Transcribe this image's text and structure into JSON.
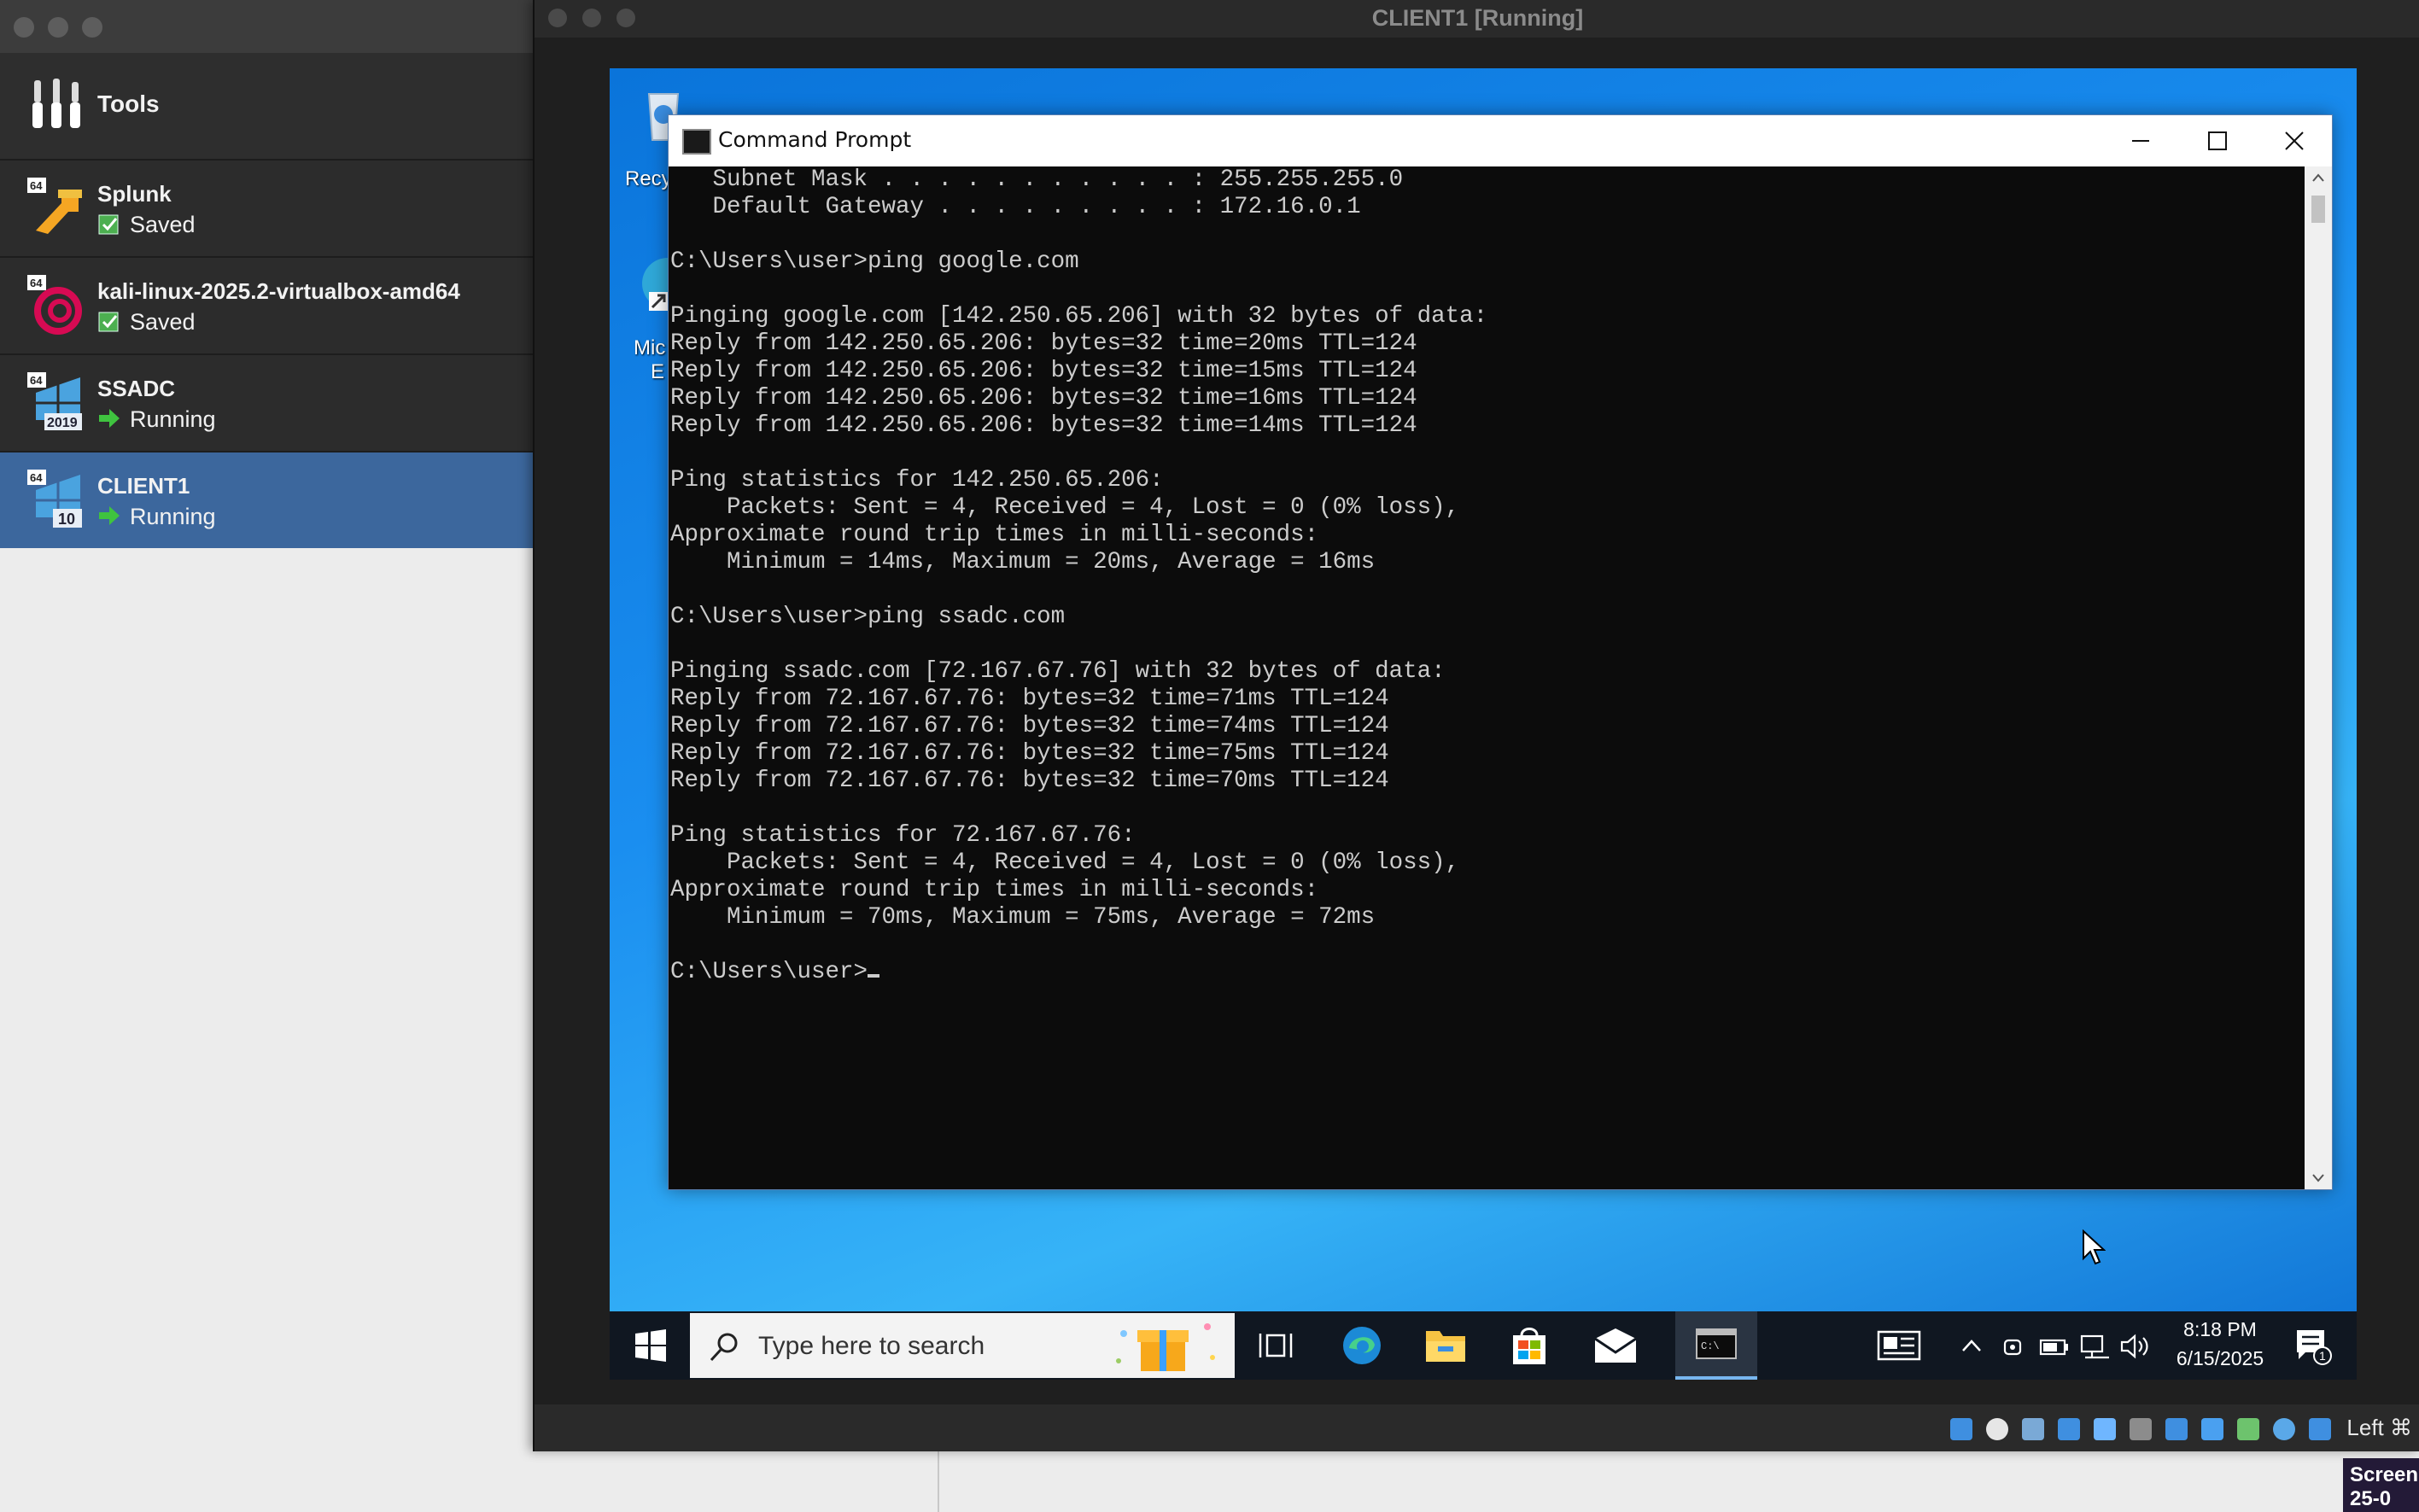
{
  "manager": {
    "tools_label": "Tools",
    "vms": [
      {
        "name": "Splunk",
        "state": "Saved"
      },
      {
        "name": "kali-linux-2025.2-virtualbox-amd64",
        "state": "Saved"
      },
      {
        "name": "SSADC",
        "state": "Running",
        "badge": "2019"
      },
      {
        "name": "CLIENT1",
        "state": "Running",
        "badge": "10"
      }
    ]
  },
  "vm_window": {
    "title": "CLIENT1 [Running]",
    "host_key": "Left ⌘"
  },
  "desktop": {
    "recycle_label": "Recy",
    "edge_label_line1": "Mic",
    "edge_label_line2": "E"
  },
  "cmd": {
    "title": "Command Prompt",
    "lines": [
      "   Subnet Mask . . . . . . . . . . . : 255.255.255.0",
      "   Default Gateway . . . . . . . . . : 172.16.0.1",
      "",
      "C:\\Users\\user>ping google.com",
      "",
      "Pinging google.com [142.250.65.206] with 32 bytes of data:",
      "Reply from 142.250.65.206: bytes=32 time=20ms TTL=124",
      "Reply from 142.250.65.206: bytes=32 time=15ms TTL=124",
      "Reply from 142.250.65.206: bytes=32 time=16ms TTL=124",
      "Reply from 142.250.65.206: bytes=32 time=14ms TTL=124",
      "",
      "Ping statistics for 142.250.65.206:",
      "    Packets: Sent = 4, Received = 4, Lost = 0 (0% loss),",
      "Approximate round trip times in milli-seconds:",
      "    Minimum = 14ms, Maximum = 20ms, Average = 16ms",
      "",
      "C:\\Users\\user>ping ssadc.com",
      "",
      "Pinging ssadc.com [72.167.67.76] with 32 bytes of data:",
      "Reply from 72.167.67.76: bytes=32 time=71ms TTL=124",
      "Reply from 72.167.67.76: bytes=32 time=74ms TTL=124",
      "Reply from 72.167.67.76: bytes=32 time=75ms TTL=124",
      "Reply from 72.167.67.76: bytes=32 time=70ms TTL=124",
      "",
      "Ping statistics for 72.167.67.76:",
      "    Packets: Sent = 4, Received = 4, Lost = 0 (0% loss),",
      "Approximate round trip times in milli-seconds:",
      "    Minimum = 70ms, Maximum = 75ms, Average = 72ms",
      ""
    ],
    "prompt": "C:\\Users\\user>"
  },
  "taskbar": {
    "search_placeholder": "Type here to search",
    "time": "8:18 PM",
    "date": "6/15/2025",
    "notification_count": "1"
  },
  "screen_peek_text": "Screen\n25-0",
  "colors": {
    "selected_row": "#3c679d",
    "running_arrow": "#3fc33f",
    "saved_badge": "#4caf50",
    "desktop_blue": "#1a8ef0",
    "taskbar": "#101721"
  }
}
